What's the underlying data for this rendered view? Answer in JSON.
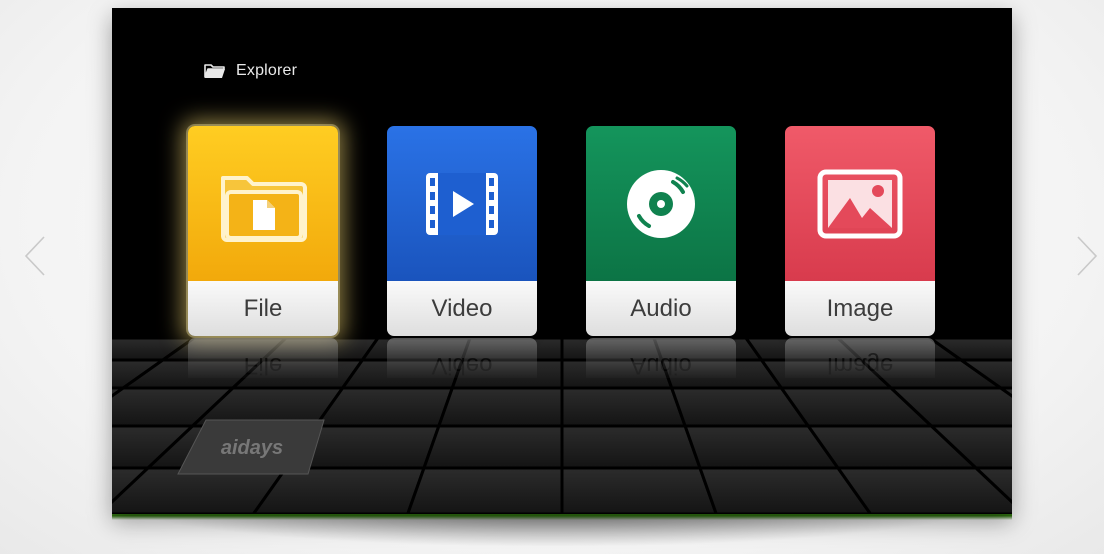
{
  "header": {
    "title": "Explorer",
    "icon": "folder-icon"
  },
  "navigation": {
    "previous_icon": "chevron-left-icon",
    "next_icon": "chevron-right-icon"
  },
  "tiles": [
    {
      "label": "File",
      "icon": "file-folder-icon",
      "color": "#F6B712",
      "focused": true
    },
    {
      "label": "Video",
      "icon": "film-play-icon",
      "color": "#1E5FD0",
      "focused": false
    },
    {
      "label": "Audio",
      "icon": "disc-icon",
      "color": "#10824F",
      "focused": false
    },
    {
      "label": "Image",
      "icon": "picture-icon",
      "color": "#E4495A",
      "focused": false
    }
  ],
  "brand": {
    "logo_text": "aidays"
  },
  "colors": {
    "screen_background": "#000000",
    "glow": "#4A9A1C",
    "label_text": "#3C3C3C"
  }
}
